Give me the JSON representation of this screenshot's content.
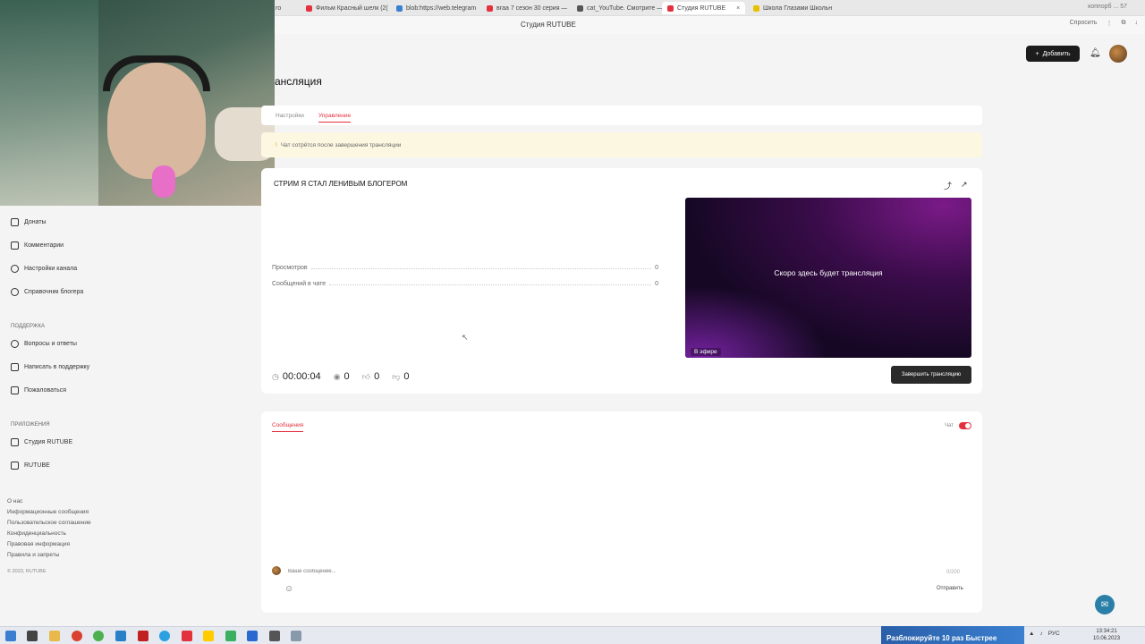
{
  "browser": {
    "tabs": [
      {
        "label": "го",
        "color": "#cc0000"
      },
      {
        "label": "Фильм Красный шелк (2(",
        "color": "#e4313e"
      },
      {
        "label": "blob:https://web.telegram",
        "color": "#3a7fd0"
      },
      {
        "label": "вгаа 7 сезон 30 серия —",
        "color": "#e4313e"
      },
      {
        "label": "cat_YouTube. Смотрите —",
        "color": "#555555"
      },
      {
        "label": "Студия RUTUBE",
        "color": "#e4313e"
      },
      {
        "label": "Школа Глазами Школьн",
        "color": "#e8c000"
      }
    ],
    "tab_close": "×",
    "info_right": "коппорб ... 57",
    "window_title": "Студия RUTUBE",
    "share_label": "Спросить"
  },
  "header": {
    "add_button": "Добавить",
    "add_icon": "+"
  },
  "page": {
    "title": "ансляция",
    "tabs": [
      {
        "label": "Настройки",
        "active": false
      },
      {
        "label": "Управление",
        "active": true
      }
    ],
    "notice": "Чат сотрётся после завершения трансляции"
  },
  "sidebar": {
    "items": [
      {
        "label": "Донаты",
        "icon": "wallet-icon"
      },
      {
        "label": "Комментарии",
        "icon": "comment-icon"
      },
      {
        "label": "Настройки канала",
        "icon": "gear-icon"
      },
      {
        "label": "Справочник блогера",
        "icon": "info-icon"
      }
    ],
    "support_heading": "Поддержка",
    "support_items": [
      {
        "label": "Вопросы и ответы",
        "icon": "question-icon"
      },
      {
        "label": "Написать в поддержку",
        "icon": "mail-icon"
      },
      {
        "label": "Пожаловаться",
        "icon": "flag-icon"
      }
    ],
    "apps_heading": "Приложения",
    "apps_items": [
      {
        "label": "Студия RUTUBE",
        "icon": "studio-icon"
      },
      {
        "label": "RUTUBE",
        "icon": "rutube-icon"
      }
    ],
    "footer_links": [
      "О нас",
      "Информационные сообщения",
      "Пользовательское соглашение",
      "Конфиденциальность",
      "Правовая информация",
      "Правила и запреты"
    ],
    "copyright": "© 2023, RUTUBE"
  },
  "stream": {
    "title": "стрим я стал ленивым блогером",
    "stats": [
      {
        "label": "Просмотров",
        "value": "0"
      },
      {
        "label": "Сообщений в чате",
        "value": "0"
      }
    ],
    "player_text": "Скоро здесь будет трансляция",
    "live_badge": "В эфире",
    "duration": "00:00:04",
    "viewers": "0",
    "likes": "0",
    "dislikes": "0",
    "finish_button": "Завершить трансляцию"
  },
  "chat": {
    "tab": "Сообщения",
    "toggle_label": "Чат",
    "toggle_on": true,
    "input_placeholder": "Ваше сообщение...",
    "counter": "0/200",
    "send_button": "Отправить"
  },
  "taskbar": {
    "ad_text": "Разблокируйте 10 раз Быстрее",
    "lang": "РУС",
    "time": "13:34:21",
    "date": "10.06.2023"
  }
}
